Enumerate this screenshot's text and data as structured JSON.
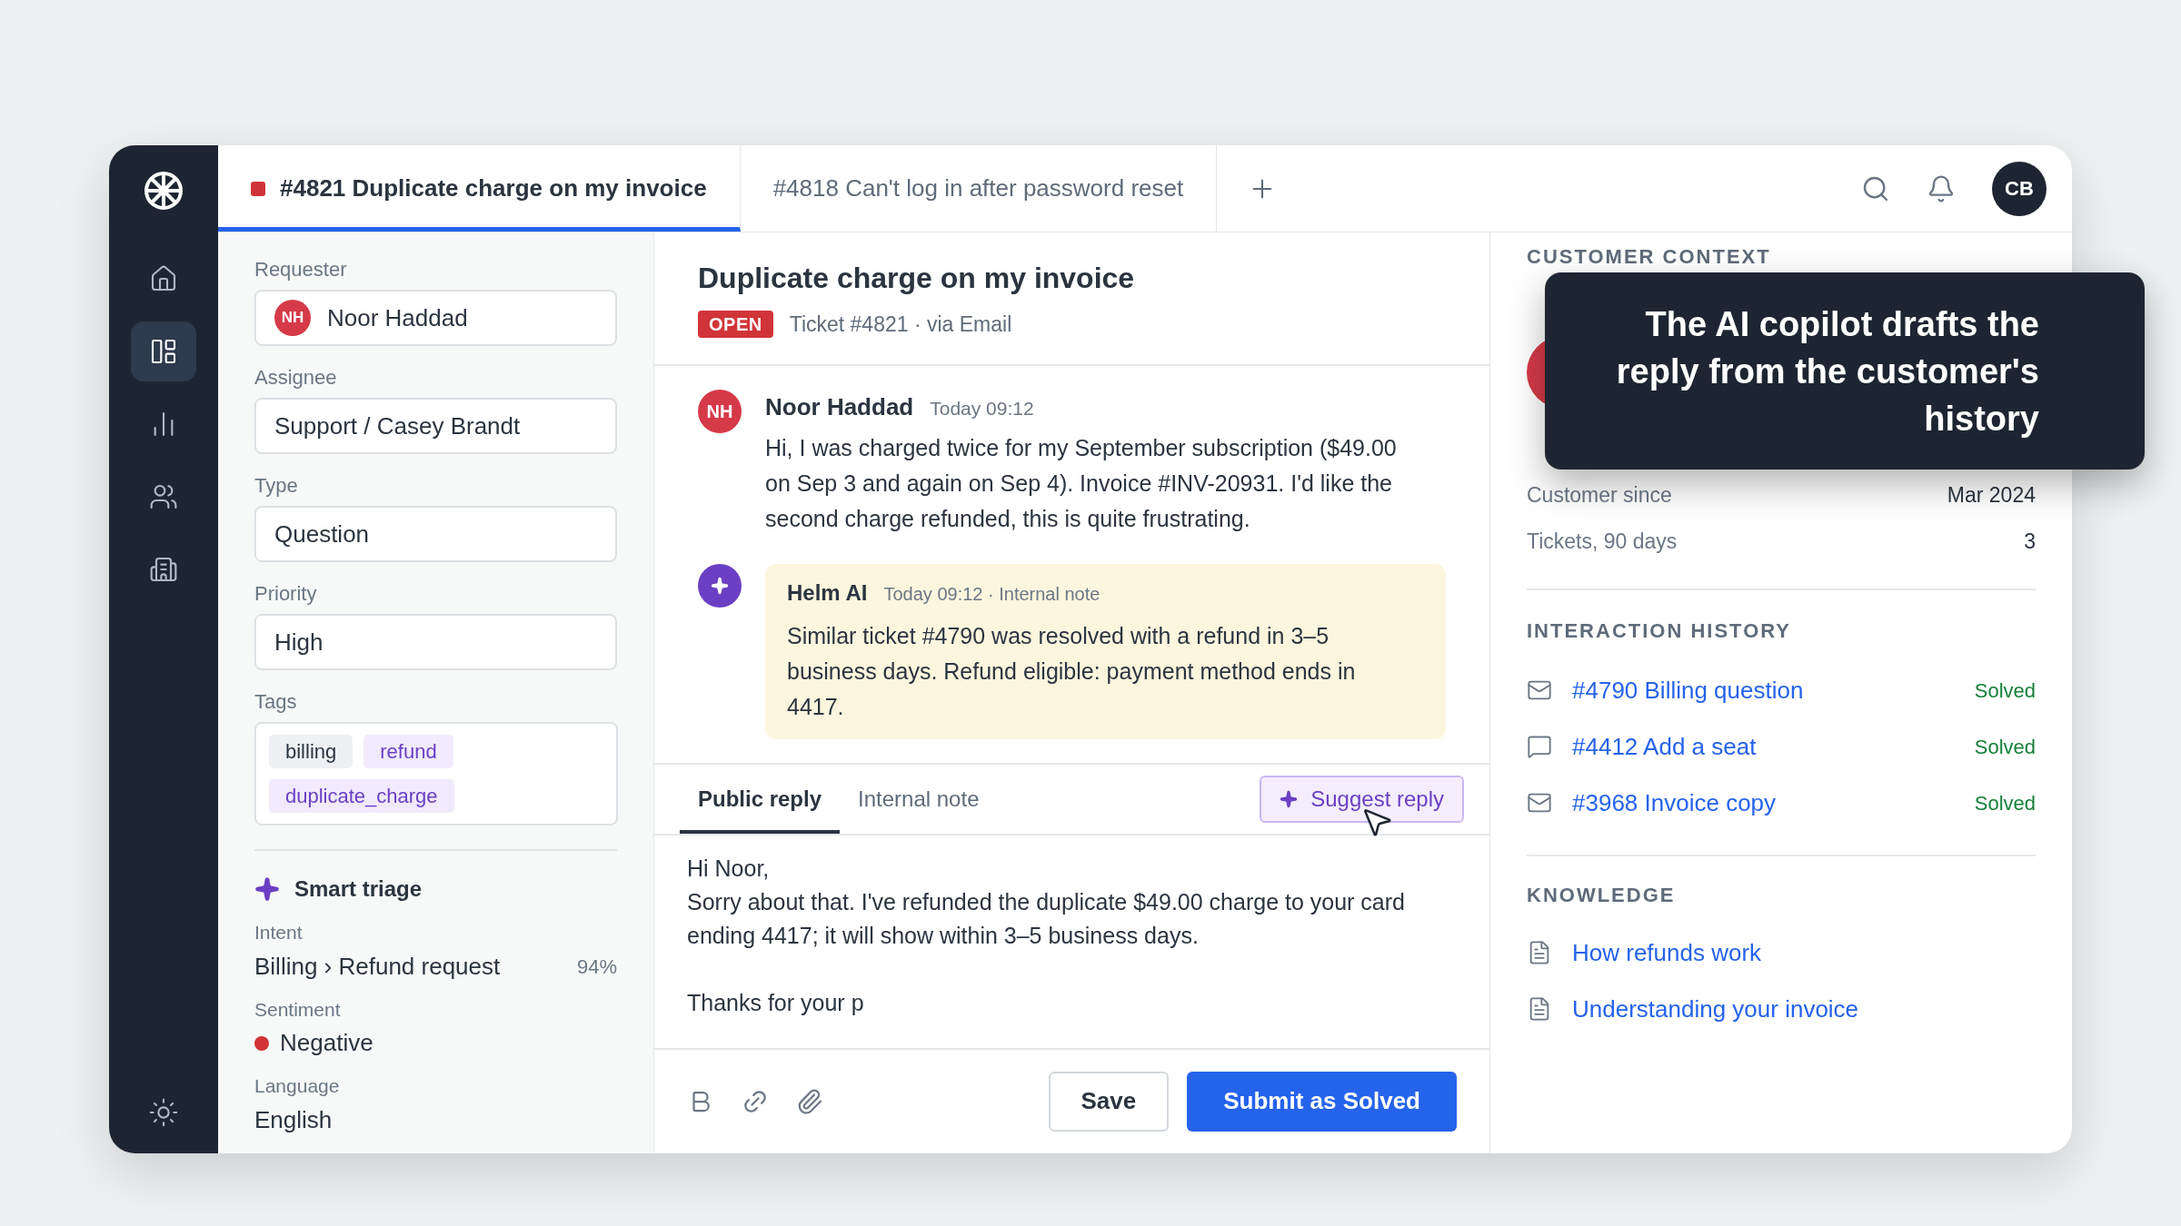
{
  "sidebar": {
    "items": [
      {
        "selected": false
      },
      {
        "selected": true
      },
      {
        "selected": false
      },
      {
        "selected": false
      },
      {
        "selected": false
      }
    ]
  },
  "tabs": [
    {
      "label": "#4821 Duplicate charge on my invoice",
      "selected": true,
      "color": "#d13438"
    },
    {
      "label": "#4818 Can't log in after password reset",
      "selected": false
    }
  ],
  "topbar": {
    "avatar": "CB"
  },
  "fields": [
    {
      "label": "Requester",
      "avatar": "NH",
      "value": "Noor Haddad"
    },
    {
      "label": "Assignee",
      "value": "Support / Casey Brandt"
    },
    {
      "label": "Type",
      "value": "Question"
    },
    {
      "label": "Priority",
      "value": "High"
    }
  ],
  "tags": {
    "label": "Tags",
    "items": [
      {
        "label": "billing",
        "color": "#eef0f3"
      },
      {
        "label": "refund",
        "color": "#f1eafc"
      },
      {
        "label": "duplicate_charge",
        "color": "#f1eafc"
      }
    ]
  },
  "smart_triage": {
    "title": "Smart triage",
    "intent_label": "Intent",
    "intent": "Billing › Refund request",
    "confidence": "94%",
    "sentiment_label": "Sentiment",
    "sentiment": {
      "label": "Negative",
      "color": "#d13438"
    },
    "language_label": "Language",
    "language": "English"
  },
  "ticket": {
    "title": "Duplicate charge on my invoice",
    "status": "OPEN",
    "meta": "Ticket #4821 · via Email"
  },
  "messages": [
    {
      "kind": "customer",
      "avatar": "NH",
      "author": "Noor Haddad",
      "time": "Today 09:12",
      "body": "Hi, I was charged twice for my September subscription ($49.00 on Sep 3 and again on Sep 4). Invoice #INV-20931. I'd like the second charge refunded, this is quite frustrating."
    },
    {
      "kind": "ai_note",
      "author": "Helm AI",
      "time": "Today 09:12 · Internal note",
      "body": "Similar ticket #4790 was resolved with a refund in 3–5 business days. Refund eligible: payment method ends in 4417."
    }
  ],
  "composer": {
    "tabs": [
      {
        "label": "Public reply",
        "selected": true
      },
      {
        "label": "Internal note",
        "selected": false
      }
    ],
    "suggest_button": "Suggest reply",
    "draft": "Hi Noor,\nSorry about that. I've refunded the duplicate $49.00 charge to your card ending 4417; it will show within 3–5 business days.\n\nThanks for your p",
    "save": "Save",
    "submit": "Submit as Solved"
  },
  "customer_context": {
    "title": "CUSTOMER CONTEXT",
    "rows": [
      {
        "label": "Customer since",
        "value": "Mar 2024"
      },
      {
        "label": "Tickets, 90 days",
        "value": "3"
      }
    ]
  },
  "interaction_history": {
    "title": "INTERACTION HISTORY",
    "items": [
      {
        "kind": "email",
        "title": "#4790 Billing question",
        "status": "Solved"
      },
      {
        "kind": "chat",
        "title": "#4412 Add a seat",
        "status": "Solved"
      },
      {
        "kind": "email",
        "title": "#3968 Invoice copy",
        "status": "Solved"
      }
    ]
  },
  "knowledge": {
    "title": "KNOWLEDGE",
    "items": [
      {
        "title": "How refunds work"
      },
      {
        "title": "Understanding your invoice"
      }
    ]
  },
  "tooltip": {
    "text": "The AI copilot drafts the reply from the customer's history"
  }
}
